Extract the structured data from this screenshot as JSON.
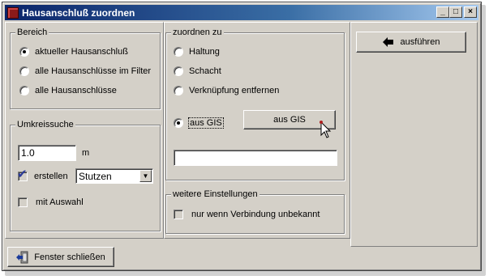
{
  "window": {
    "title": "Hausanschluß zuordnen",
    "controls": [
      "_",
      "□",
      "×"
    ]
  },
  "bereich": {
    "legend": "Bereich",
    "options": [
      "aktueller Hausanschluß",
      "alle Hausanschlüsse im Filter",
      "alle Hausanschlüsse"
    ],
    "selected_index": 0
  },
  "umkreissuche": {
    "legend": "Umkreissuche",
    "distance_value": "1.0",
    "distance_unit": "m",
    "create_label": "erstellen",
    "create_checked": true,
    "type_select_value": "Stutzen",
    "with_selection_label": "mit Auswahl",
    "with_selection_checked": false
  },
  "zuordnen": {
    "legend": "zuordnen zu",
    "options": [
      "Haltung",
      "Schacht",
      "Verknüpfung entfernen",
      "aus GIS"
    ],
    "selected_index": 3,
    "gis_button_label": "aus GIS",
    "gis_result_value": ""
  },
  "weitere": {
    "legend": "weitere Einstellungen",
    "only_if_unknown_label": "nur wenn Verbindung unbekannt",
    "only_if_unknown_checked": false
  },
  "actions": {
    "execute_label": "ausführen",
    "close_label": "Fenster schließen"
  },
  "icons": {
    "app": "app-icon",
    "execute": "arrow-left-icon",
    "close": "exit-door-icon",
    "gis_cursor": "mouse-pointer-icon"
  },
  "colors": {
    "title_start": "#0a246a",
    "title_end": "#a6caf0",
    "face": "#d4d0c8"
  }
}
